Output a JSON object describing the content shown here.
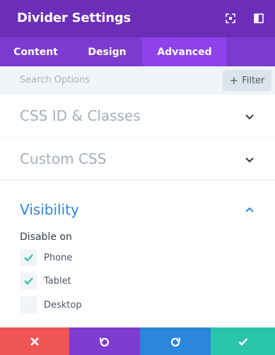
{
  "header": {
    "title": "Divider Settings",
    "icons": [
      "fullscreen-icon",
      "sidebar-toggle-icon"
    ]
  },
  "tabs": [
    {
      "label": "Content",
      "active": false
    },
    {
      "label": "Design",
      "active": false
    },
    {
      "label": "Advanced",
      "active": true
    }
  ],
  "search": {
    "placeholder": "Search Options",
    "filter_label": "Filter",
    "filter_icon": "+"
  },
  "sections": [
    {
      "title": "CSS ID & Classes",
      "expanded": false
    },
    {
      "title": "Custom CSS",
      "expanded": false
    },
    {
      "title": "Visibility",
      "expanded": true
    }
  ],
  "visibility": {
    "label": "Disable on",
    "options": [
      {
        "label": "Phone",
        "checked": true
      },
      {
        "label": "Tablet",
        "checked": true
      },
      {
        "label": "Desktop",
        "checked": false
      }
    ]
  },
  "footer": {
    "buttons": [
      "cancel-icon",
      "undo-icon",
      "redo-icon",
      "save-icon"
    ]
  },
  "colors": {
    "header": "#6c2eb9",
    "tabs": "#7c3bd0",
    "tab_active": "#8f42ec",
    "accent_blue": "#2b87da",
    "check": "#29c4a9",
    "cancel": "#ef5555",
    "undo": "#7e3bd0",
    "redo": "#2b87da",
    "save": "#29c4a9"
  }
}
